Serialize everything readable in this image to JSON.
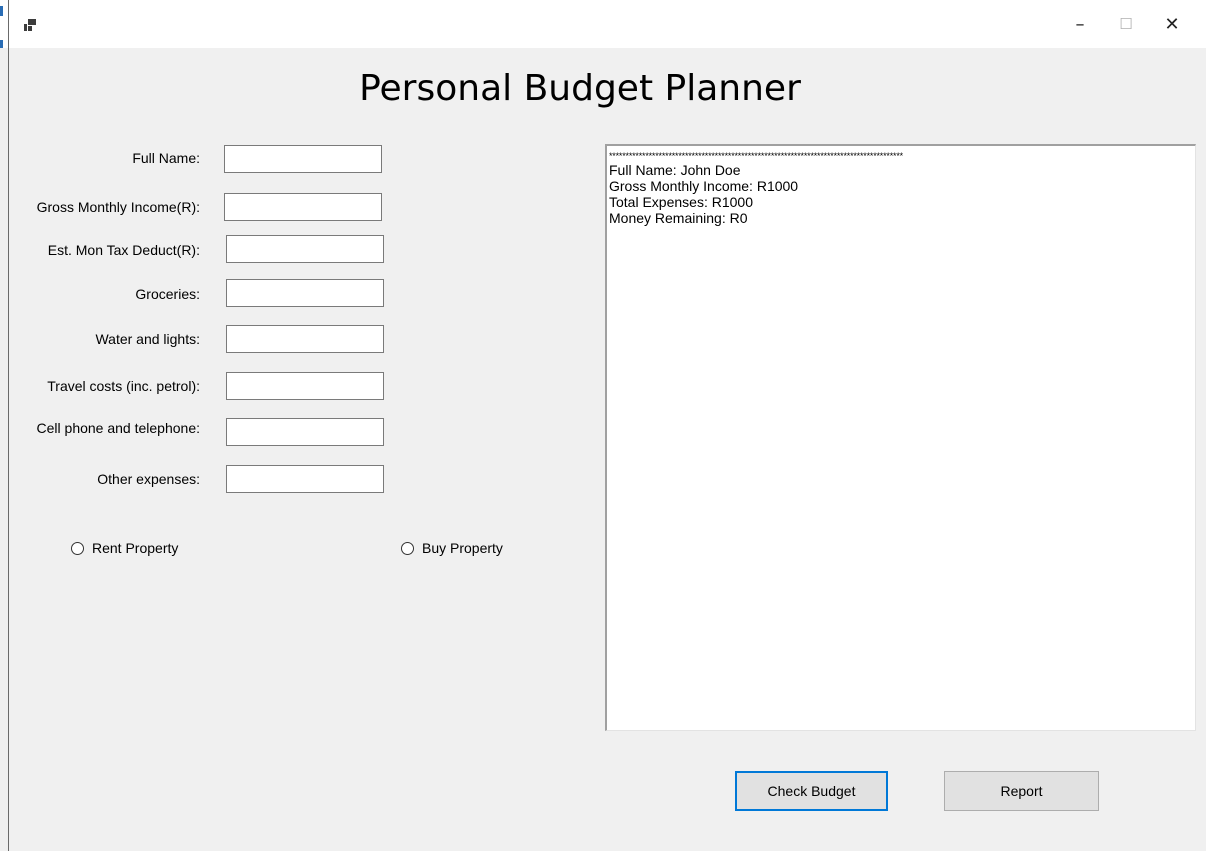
{
  "window": {
    "minimize_glyph": "–",
    "maximize_glyph": "☐",
    "close_glyph": "✕"
  },
  "title": "Personal Budget Planner",
  "form": {
    "fields": [
      {
        "label": "Full Name:",
        "value": ""
      },
      {
        "label": "Gross Monthly Income(R):",
        "value": ""
      },
      {
        "label": "Est. Mon Tax Deduct(R):",
        "value": ""
      },
      {
        "label": "Groceries:",
        "value": ""
      },
      {
        "label": "Water and lights:",
        "value": ""
      },
      {
        "label": "Travel costs (inc. petrol):",
        "value": ""
      },
      {
        "label": "Cell phone and telephone:",
        "value": ""
      },
      {
        "label": "Other expenses:",
        "value": ""
      }
    ],
    "rent_label": "Rent Property",
    "buy_label": "Buy Property"
  },
  "output": {
    "separator": "*****************************************************************************************",
    "lines": [
      "Full Name: John Doe",
      "Gross Monthly Income: R1000",
      "Total Expenses: R1000",
      "Money Remaining: R0"
    ]
  },
  "buttons": {
    "check_budget": "Check Budget",
    "report": "Report"
  }
}
